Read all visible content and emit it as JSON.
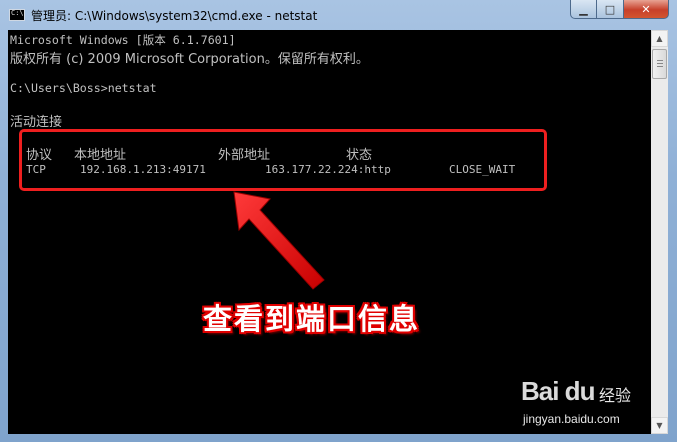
{
  "window": {
    "title": "管理员: C:\\Windows\\system32\\cmd.exe - netstat",
    "icon": "cmd-icon",
    "controls": {
      "minimize": "minimize-icon",
      "maximize": "maximize-icon",
      "close": "close-icon"
    }
  },
  "console": {
    "line1": "Microsoft Windows [版本 6.1.7601]",
    "line2": "版权所有 (c) 2009 Microsoft Corporation。保留所有权利。",
    "prompt": "C:\\Users\\Boss>netstat",
    "section_title": "活动连接",
    "headers": {
      "proto": "协议",
      "local": "本地地址",
      "foreign": "外部地址",
      "state": "状态"
    },
    "row": {
      "proto": "TCP",
      "local": "192.168.1.213:49171",
      "foreign": "163.177.22.224:http",
      "state": "CLOSE_WAIT"
    }
  },
  "annotation": {
    "text": "查看到端口信息",
    "color": "#e00000"
  },
  "watermark": {
    "logo": "Bai du",
    "cn": "经验",
    "url": "jingyan.baidu.com"
  },
  "colors": {
    "console_bg": "#000000",
    "console_text": "#c0c0c0",
    "highlight": "#ee1f1f"
  }
}
